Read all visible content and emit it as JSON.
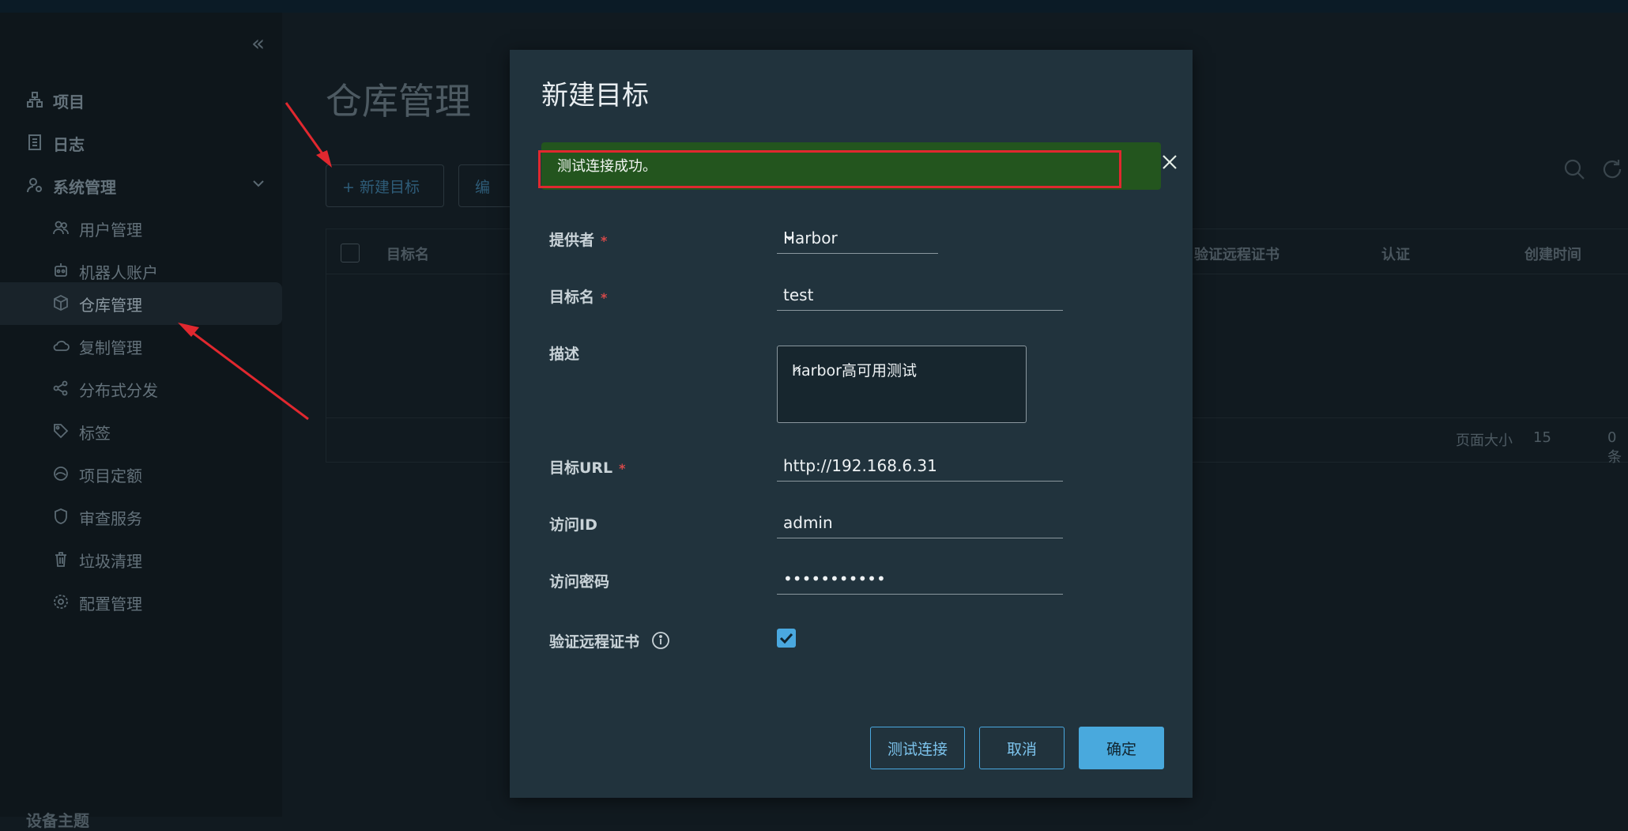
{
  "sidebar": {
    "items": [
      {
        "label": "项目"
      },
      {
        "label": "日志"
      },
      {
        "label": "系统管理"
      },
      {
        "label": "用户管理"
      },
      {
        "label": "机器人账户"
      },
      {
        "label": "仓库管理"
      },
      {
        "label": "复制管理"
      },
      {
        "label": "分布式分发"
      },
      {
        "label": "标签"
      },
      {
        "label": "项目定额"
      },
      {
        "label": "审查服务"
      },
      {
        "label": "垃圾清理"
      },
      {
        "label": "配置管理"
      }
    ],
    "bottom_item": "设备主题"
  },
  "page": {
    "title": "仓库管理",
    "new_target_button": "+ 新建目标",
    "edit_button": "编",
    "columns": [
      "目标名",
      "验证远程证书",
      "认证",
      "创建时间"
    ],
    "page_size_label": "页面大小",
    "page_size_value": "15",
    "count_text": "0 条"
  },
  "modal": {
    "title": "新建目标",
    "alert_text": "测试连接成功。",
    "fields": {
      "provider_label": "提供者",
      "provider_value": "Harbor",
      "name_label": "目标名",
      "name_value": "test",
      "description_label": "描述",
      "description_value": "harbor高可用测试",
      "url_label": "目标URL",
      "url_value": "http://192.168.6.31",
      "access_id_label": "访问ID",
      "access_id_value": "admin",
      "password_label": "访问密码",
      "password_value": "•••••••••••",
      "verify_cert_label": "验证远程证书",
      "required_mark": "*"
    },
    "buttons": {
      "test": "测试连接",
      "cancel": "取消",
      "ok": "确定"
    }
  },
  "colors": {
    "accent": "#49a9dd",
    "success_bg": "#23551e",
    "highlight": "#e1282f"
  }
}
